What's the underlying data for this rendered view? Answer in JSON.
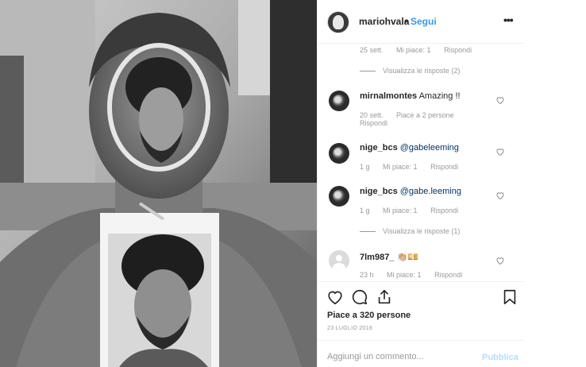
{
  "post": {
    "username": "mariohvala",
    "separator": "•",
    "follow_label": "Segui",
    "more_label": "•••",
    "likes_text": "Piace a 320 persone",
    "date": "23 LUGLIO 2018",
    "add_comment_placeholder": "Aggiungi un commento...",
    "publish_label": "Pubblica"
  },
  "comments": [
    {
      "meta": {
        "time": "25 sett.",
        "likes": "Mi piace: 1",
        "reply": "Rispondi"
      },
      "view_replies": "Visualizza le risposte (2)"
    },
    {
      "username": "mirnalmontes",
      "text": "Amazing !!",
      "meta": {
        "time": "20 sett.",
        "likes": "Piace a 2 persone",
        "reply": "Rispondi"
      }
    },
    {
      "username": "nige_bcs",
      "mention": "@gabeleeming",
      "meta": {
        "time": "1 g",
        "likes": "Mi piace: 1",
        "reply": "Rispondi"
      }
    },
    {
      "username": "nige_bcs",
      "mention": "@gabe.leeming",
      "meta": {
        "time": "1 g",
        "likes": "Mi piace: 1",
        "reply": "Rispondi"
      },
      "view_replies": "Visualizza le risposte (1)"
    },
    {
      "username": "7lm987_",
      "text": "👏🏼💴",
      "meta": {
        "time": "23 h",
        "likes": "Mi piace: 1",
        "reply": "Rispondi"
      }
    }
  ],
  "icons": {
    "heart": "heart-icon",
    "comment": "comment-icon",
    "share": "share-icon",
    "bookmark": "bookmark-icon",
    "more": "more-icon"
  },
  "colors": {
    "link_blue": "#3897f0",
    "mention_blue": "#003569",
    "muted_grey": "#999999",
    "text": "#262626",
    "publish_disabled": "#b2dffc"
  }
}
